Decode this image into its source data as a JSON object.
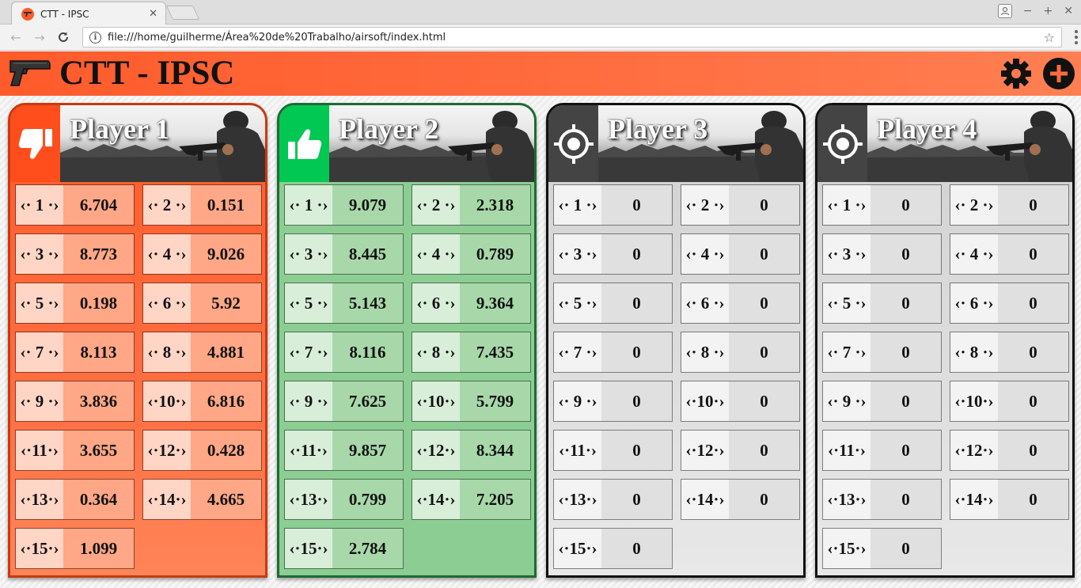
{
  "browser": {
    "tab_title": "CTT - IPSC",
    "url": "file:///home/guilherme/Área%20de%20Trabalho/airsoft/index.html"
  },
  "app": {
    "title": "CTT - IPSC",
    "header_icons": [
      "pistol-icon",
      "gear-icon",
      "add-icon"
    ],
    "colors": {
      "header": "#ff6b3d",
      "red": "#ff5b2b",
      "green": "#00c853",
      "gray": "#444444"
    }
  },
  "players": [
    {
      "name": "Player 1",
      "status_icon": "thumbs-down-icon",
      "theme": "red",
      "shots": [
        {
          "label": "‹· 1 ·›",
          "value": "6.704"
        },
        {
          "label": "‹· 2 ·›",
          "value": "0.151"
        },
        {
          "label": "‹· 3 ·›",
          "value": "8.773"
        },
        {
          "label": "‹· 4 ·›",
          "value": "9.026"
        },
        {
          "label": "‹· 5 ·›",
          "value": "0.198"
        },
        {
          "label": "‹· 6 ·›",
          "value": "5.92"
        },
        {
          "label": "‹· 7 ·›",
          "value": "8.113"
        },
        {
          "label": "‹· 8 ·›",
          "value": "4.881"
        },
        {
          "label": "‹· 9 ·›",
          "value": "3.836"
        },
        {
          "label": "‹·10·›",
          "value": "6.816"
        },
        {
          "label": "‹·11·›",
          "value": "3.655"
        },
        {
          "label": "‹·12·›",
          "value": "0.428"
        },
        {
          "label": "‹·13·›",
          "value": "0.364"
        },
        {
          "label": "‹·14·›",
          "value": "4.665"
        },
        {
          "label": "‹·15·›",
          "value": "1.099"
        }
      ]
    },
    {
      "name": "Player 2",
      "status_icon": "thumbs-up-icon",
      "theme": "green",
      "shots": [
        {
          "label": "‹· 1 ·›",
          "value": "9.079"
        },
        {
          "label": "‹· 2 ·›",
          "value": "2.318"
        },
        {
          "label": "‹· 3 ·›",
          "value": "8.445"
        },
        {
          "label": "‹· 4 ·›",
          "value": "0.789"
        },
        {
          "label": "‹· 5 ·›",
          "value": "5.143"
        },
        {
          "label": "‹· 6 ·›",
          "value": "9.364"
        },
        {
          "label": "‹· 7 ·›",
          "value": "8.116"
        },
        {
          "label": "‹· 8 ·›",
          "value": "7.435"
        },
        {
          "label": "‹· 9 ·›",
          "value": "7.625"
        },
        {
          "label": "‹·10·›",
          "value": "5.799"
        },
        {
          "label": "‹·11·›",
          "value": "9.857"
        },
        {
          "label": "‹·12·›",
          "value": "8.344"
        },
        {
          "label": "‹·13·›",
          "value": "0.799"
        },
        {
          "label": "‹·14·›",
          "value": "7.205"
        },
        {
          "label": "‹·15·›",
          "value": "2.784"
        }
      ]
    },
    {
      "name": "Player 3",
      "status_icon": "target-icon",
      "theme": "gray",
      "shots": [
        {
          "label": "‹· 1 ·›",
          "value": "0"
        },
        {
          "label": "‹· 2 ·›",
          "value": "0"
        },
        {
          "label": "‹· 3 ·›",
          "value": "0"
        },
        {
          "label": "‹· 4 ·›",
          "value": "0"
        },
        {
          "label": "‹· 5 ·›",
          "value": "0"
        },
        {
          "label": "‹· 6 ·›",
          "value": "0"
        },
        {
          "label": "‹· 7 ·›",
          "value": "0"
        },
        {
          "label": "‹· 8 ·›",
          "value": "0"
        },
        {
          "label": "‹· 9 ·›",
          "value": "0"
        },
        {
          "label": "‹·10·›",
          "value": "0"
        },
        {
          "label": "‹·11·›",
          "value": "0"
        },
        {
          "label": "‹·12·›",
          "value": "0"
        },
        {
          "label": "‹·13·›",
          "value": "0"
        },
        {
          "label": "‹·14·›",
          "value": "0"
        },
        {
          "label": "‹·15·›",
          "value": "0"
        }
      ]
    },
    {
      "name": "Player 4",
      "status_icon": "target-icon",
      "theme": "gray",
      "shots": [
        {
          "label": "‹· 1 ·›",
          "value": "0"
        },
        {
          "label": "‹· 2 ·›",
          "value": "0"
        },
        {
          "label": "‹· 3 ·›",
          "value": "0"
        },
        {
          "label": "‹· 4 ·›",
          "value": "0"
        },
        {
          "label": "‹· 5 ·›",
          "value": "0"
        },
        {
          "label": "‹· 6 ·›",
          "value": "0"
        },
        {
          "label": "‹· 7 ·›",
          "value": "0"
        },
        {
          "label": "‹· 8 ·›",
          "value": "0"
        },
        {
          "label": "‹· 9 ·›",
          "value": "0"
        },
        {
          "label": "‹·10·›",
          "value": "0"
        },
        {
          "label": "‹·11·›",
          "value": "0"
        },
        {
          "label": "‹·12·›",
          "value": "0"
        },
        {
          "label": "‹·13·›",
          "value": "0"
        },
        {
          "label": "‹·14·›",
          "value": "0"
        },
        {
          "label": "‹·15·›",
          "value": "0"
        }
      ]
    }
  ]
}
